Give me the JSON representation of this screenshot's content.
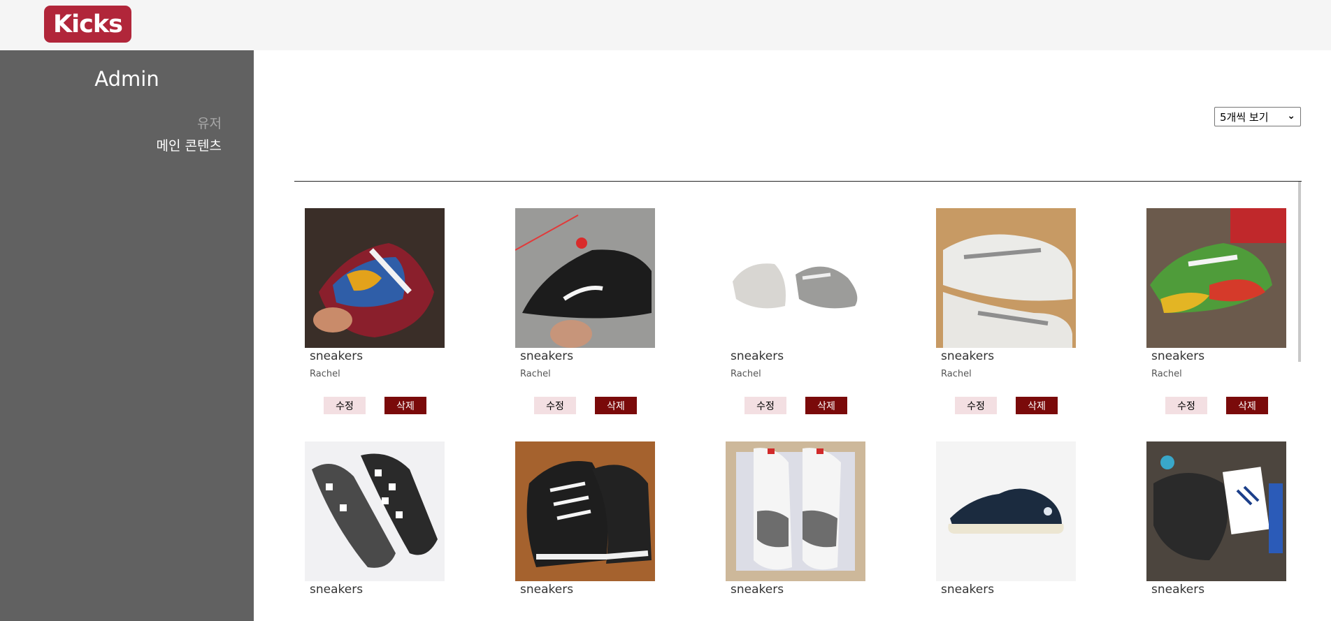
{
  "header": {
    "logo_text": "Kicks",
    "logo_color": "#b1263a"
  },
  "sidebar": {
    "title": "Admin",
    "items": [
      {
        "label": "유저",
        "active": false
      },
      {
        "label": "메인 콘텐츠",
        "active": true
      }
    ]
  },
  "toolbar": {
    "per_page_selected": "5개씩 보기"
  },
  "products": [
    {
      "title": "sneakers",
      "author": "Rachel",
      "edit_label": "수정",
      "delete_label": "삭제"
    },
    {
      "title": "sneakers",
      "author": "Rachel",
      "edit_label": "수정",
      "delete_label": "삭제"
    },
    {
      "title": "sneakers",
      "author": "Rachel",
      "edit_label": "수정",
      "delete_label": "삭제"
    },
    {
      "title": "sneakers",
      "author": "Rachel",
      "edit_label": "수정",
      "delete_label": "삭제"
    },
    {
      "title": "sneakers",
      "author": "Rachel",
      "edit_label": "수정",
      "delete_label": "삭제"
    },
    {
      "title": "sneakers"
    },
    {
      "title": "sneakers"
    },
    {
      "title": "sneakers"
    },
    {
      "title": "sneakers"
    },
    {
      "title": "sneakers"
    }
  ]
}
